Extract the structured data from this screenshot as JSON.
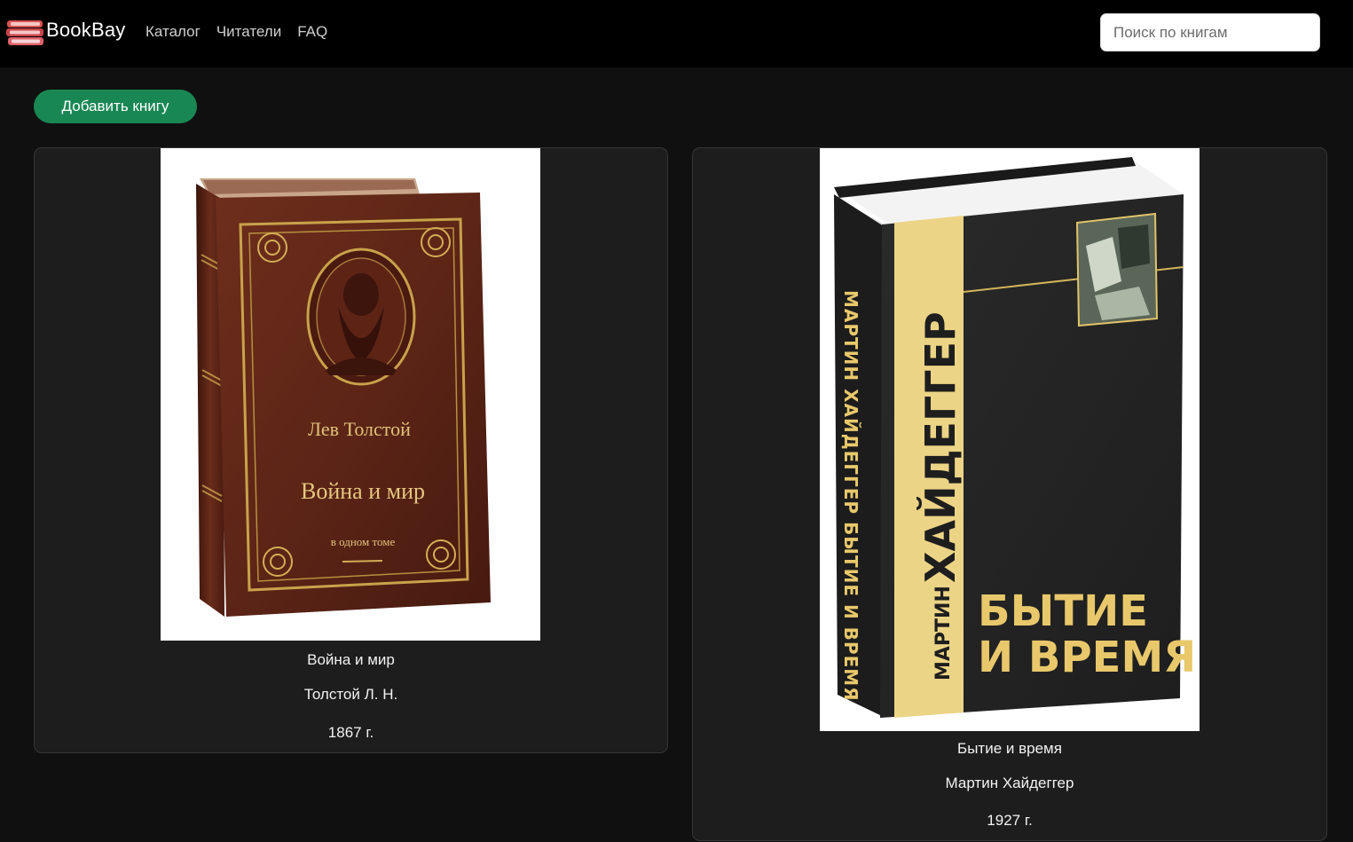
{
  "brand": {
    "name": "BookBay",
    "icon": "books-stack-icon"
  },
  "nav": {
    "items": [
      {
        "label": "Каталог"
      },
      {
        "label": "Читатели"
      },
      {
        "label": "FAQ"
      }
    ]
  },
  "search": {
    "placeholder": "Поиск по книгам",
    "value": ""
  },
  "actions": {
    "add_label": "Добавить книгу"
  },
  "colors": {
    "navbar_bg": "#000000",
    "page_bg": "#101010",
    "card_bg": "#1d1d1d",
    "accent_green": "#198754"
  },
  "books": [
    {
      "title": "Война и мир",
      "author": "Толстой Л. Н.",
      "year": "1867 г.",
      "cover": {
        "author_text": "Лев Толстой",
        "title_text": "Война и мир",
        "subtitle_text": "в одном томе"
      }
    },
    {
      "title": "Бытие и время",
      "author": "Мартин Хайдеггер",
      "year": "1927 г.",
      "cover": {
        "author_first": "МАРТИН",
        "author_last": "ХАЙДЕГГЕР",
        "title_line1": "БЫТИЕ",
        "title_line2": "И ВРЕМЯ",
        "spine_text": "МАРТИН ХАЙДЕГГЕР  БЫТИЕ И ВРЕМЯ"
      }
    }
  ]
}
